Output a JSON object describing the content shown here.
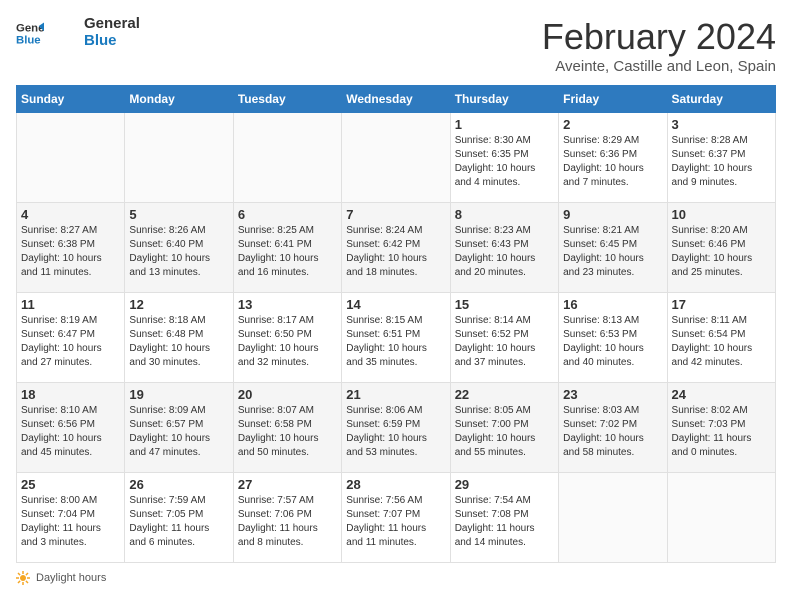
{
  "header": {
    "logo_line1": "General",
    "logo_line2": "Blue",
    "title": "February 2024",
    "subtitle": "Aveinte, Castille and Leon, Spain"
  },
  "days_of_week": [
    "Sunday",
    "Monday",
    "Tuesday",
    "Wednesday",
    "Thursday",
    "Friday",
    "Saturday"
  ],
  "weeks": [
    [
      {
        "day": "",
        "info": ""
      },
      {
        "day": "",
        "info": ""
      },
      {
        "day": "",
        "info": ""
      },
      {
        "day": "",
        "info": ""
      },
      {
        "day": "1",
        "info": "Sunrise: 8:30 AM\nSunset: 6:35 PM\nDaylight: 10 hours\nand 4 minutes."
      },
      {
        "day": "2",
        "info": "Sunrise: 8:29 AM\nSunset: 6:36 PM\nDaylight: 10 hours\nand 7 minutes."
      },
      {
        "day": "3",
        "info": "Sunrise: 8:28 AM\nSunset: 6:37 PM\nDaylight: 10 hours\nand 9 minutes."
      }
    ],
    [
      {
        "day": "4",
        "info": "Sunrise: 8:27 AM\nSunset: 6:38 PM\nDaylight: 10 hours\nand 11 minutes."
      },
      {
        "day": "5",
        "info": "Sunrise: 8:26 AM\nSunset: 6:40 PM\nDaylight: 10 hours\nand 13 minutes."
      },
      {
        "day": "6",
        "info": "Sunrise: 8:25 AM\nSunset: 6:41 PM\nDaylight: 10 hours\nand 16 minutes."
      },
      {
        "day": "7",
        "info": "Sunrise: 8:24 AM\nSunset: 6:42 PM\nDaylight: 10 hours\nand 18 minutes."
      },
      {
        "day": "8",
        "info": "Sunrise: 8:23 AM\nSunset: 6:43 PM\nDaylight: 10 hours\nand 20 minutes."
      },
      {
        "day": "9",
        "info": "Sunrise: 8:21 AM\nSunset: 6:45 PM\nDaylight: 10 hours\nand 23 minutes."
      },
      {
        "day": "10",
        "info": "Sunrise: 8:20 AM\nSunset: 6:46 PM\nDaylight: 10 hours\nand 25 minutes."
      }
    ],
    [
      {
        "day": "11",
        "info": "Sunrise: 8:19 AM\nSunset: 6:47 PM\nDaylight: 10 hours\nand 27 minutes."
      },
      {
        "day": "12",
        "info": "Sunrise: 8:18 AM\nSunset: 6:48 PM\nDaylight: 10 hours\nand 30 minutes."
      },
      {
        "day": "13",
        "info": "Sunrise: 8:17 AM\nSunset: 6:50 PM\nDaylight: 10 hours\nand 32 minutes."
      },
      {
        "day": "14",
        "info": "Sunrise: 8:15 AM\nSunset: 6:51 PM\nDaylight: 10 hours\nand 35 minutes."
      },
      {
        "day": "15",
        "info": "Sunrise: 8:14 AM\nSunset: 6:52 PM\nDaylight: 10 hours\nand 37 minutes."
      },
      {
        "day": "16",
        "info": "Sunrise: 8:13 AM\nSunset: 6:53 PM\nDaylight: 10 hours\nand 40 minutes."
      },
      {
        "day": "17",
        "info": "Sunrise: 8:11 AM\nSunset: 6:54 PM\nDaylight: 10 hours\nand 42 minutes."
      }
    ],
    [
      {
        "day": "18",
        "info": "Sunrise: 8:10 AM\nSunset: 6:56 PM\nDaylight: 10 hours\nand 45 minutes."
      },
      {
        "day": "19",
        "info": "Sunrise: 8:09 AM\nSunset: 6:57 PM\nDaylight: 10 hours\nand 47 minutes."
      },
      {
        "day": "20",
        "info": "Sunrise: 8:07 AM\nSunset: 6:58 PM\nDaylight: 10 hours\nand 50 minutes."
      },
      {
        "day": "21",
        "info": "Sunrise: 8:06 AM\nSunset: 6:59 PM\nDaylight: 10 hours\nand 53 minutes."
      },
      {
        "day": "22",
        "info": "Sunrise: 8:05 AM\nSunset: 7:00 PM\nDaylight: 10 hours\nand 55 minutes."
      },
      {
        "day": "23",
        "info": "Sunrise: 8:03 AM\nSunset: 7:02 PM\nDaylight: 10 hours\nand 58 minutes."
      },
      {
        "day": "24",
        "info": "Sunrise: 8:02 AM\nSunset: 7:03 PM\nDaylight: 11 hours\nand 0 minutes."
      }
    ],
    [
      {
        "day": "25",
        "info": "Sunrise: 8:00 AM\nSunset: 7:04 PM\nDaylight: 11 hours\nand 3 minutes."
      },
      {
        "day": "26",
        "info": "Sunrise: 7:59 AM\nSunset: 7:05 PM\nDaylight: 11 hours\nand 6 minutes."
      },
      {
        "day": "27",
        "info": "Sunrise: 7:57 AM\nSunset: 7:06 PM\nDaylight: 11 hours\nand 8 minutes."
      },
      {
        "day": "28",
        "info": "Sunrise: 7:56 AM\nSunset: 7:07 PM\nDaylight: 11 hours\nand 11 minutes."
      },
      {
        "day": "29",
        "info": "Sunrise: 7:54 AM\nSunset: 7:08 PM\nDaylight: 11 hours\nand 14 minutes."
      },
      {
        "day": "",
        "info": ""
      },
      {
        "day": "",
        "info": ""
      }
    ]
  ],
  "footer": {
    "daylight_label": "Daylight hours"
  }
}
